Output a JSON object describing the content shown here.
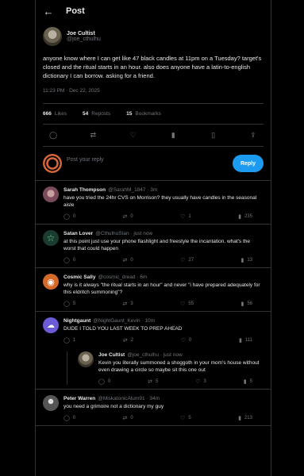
{
  "topbar": {
    "title": "Post"
  },
  "post": {
    "author_name": "Joe Cultist",
    "author_handle": "@joe_cthulhu",
    "text": "anyone know where I can get like 47 black candles at 11pm on a Tuesday? target's closed and the ritual starts in an hour. also does anyone have a latin-to-english dictionary I can borrow. asking for a friend.",
    "timestamp": "11:23 PM · Dec 22, 2025",
    "likes_count": "666",
    "likes_label": "Likes",
    "reposts_count": "54",
    "reposts_label": "Reposts",
    "bookmarks_count": "15",
    "bookmarks_label": "Bookmarks"
  },
  "reply_box": {
    "placeholder": "Post your reply",
    "button_label": "Reply"
  },
  "comments": [
    {
      "name": "Sarah Thompson",
      "meta": "@SarahM_1847 · 3m",
      "text": "have you tried the 24hr CVS on Morrison? they usually have candles in the seasonal aisle",
      "replies": "0",
      "reposts": "0",
      "likes": "1",
      "views": "235"
    },
    {
      "name": "Satan Lover",
      "meta": "@CthulhuStan · just now",
      "text": "at this point just use your phone flashlight and freestyle the incantation. what's the worst that could happen",
      "replies": "0",
      "reposts": "0",
      "likes": "27",
      "views": "13"
    },
    {
      "name": "Cosmic Sally",
      "meta": "@cosmic_dread · 6m",
      "text": "why is it always \"the ritual starts in an hour\" and never \"i have prepared adequately for this eldritch summoning\"?",
      "replies": "5",
      "reposts": "3",
      "likes": "55",
      "views": "56"
    },
    {
      "name": "Nightgaunt",
      "meta": "@NightGaunt_Kevin · 10m",
      "text": "DUDE I TOLD YOU LAST WEEK TO PREP AHEAD",
      "replies": "1",
      "reposts": "2",
      "likes": "0",
      "views": "111"
    },
    {
      "name": "Peter Warren",
      "meta": "@MiskatonicAlum91 · 34m",
      "text": "you need a grimoire not a dictionary my guy",
      "replies": "0",
      "reposts": "0",
      "likes": "5",
      "views": "213"
    }
  ],
  "nested_reply": {
    "name": "Joe Cultist",
    "meta": "@joe_cthulhu · just now",
    "text": "Kevin you literally summoned a shoggoth in your mom's house without even drawing a circle so maybe sit this one out",
    "replies": "0",
    "reposts": "5",
    "likes": "3",
    "views": "5"
  }
}
